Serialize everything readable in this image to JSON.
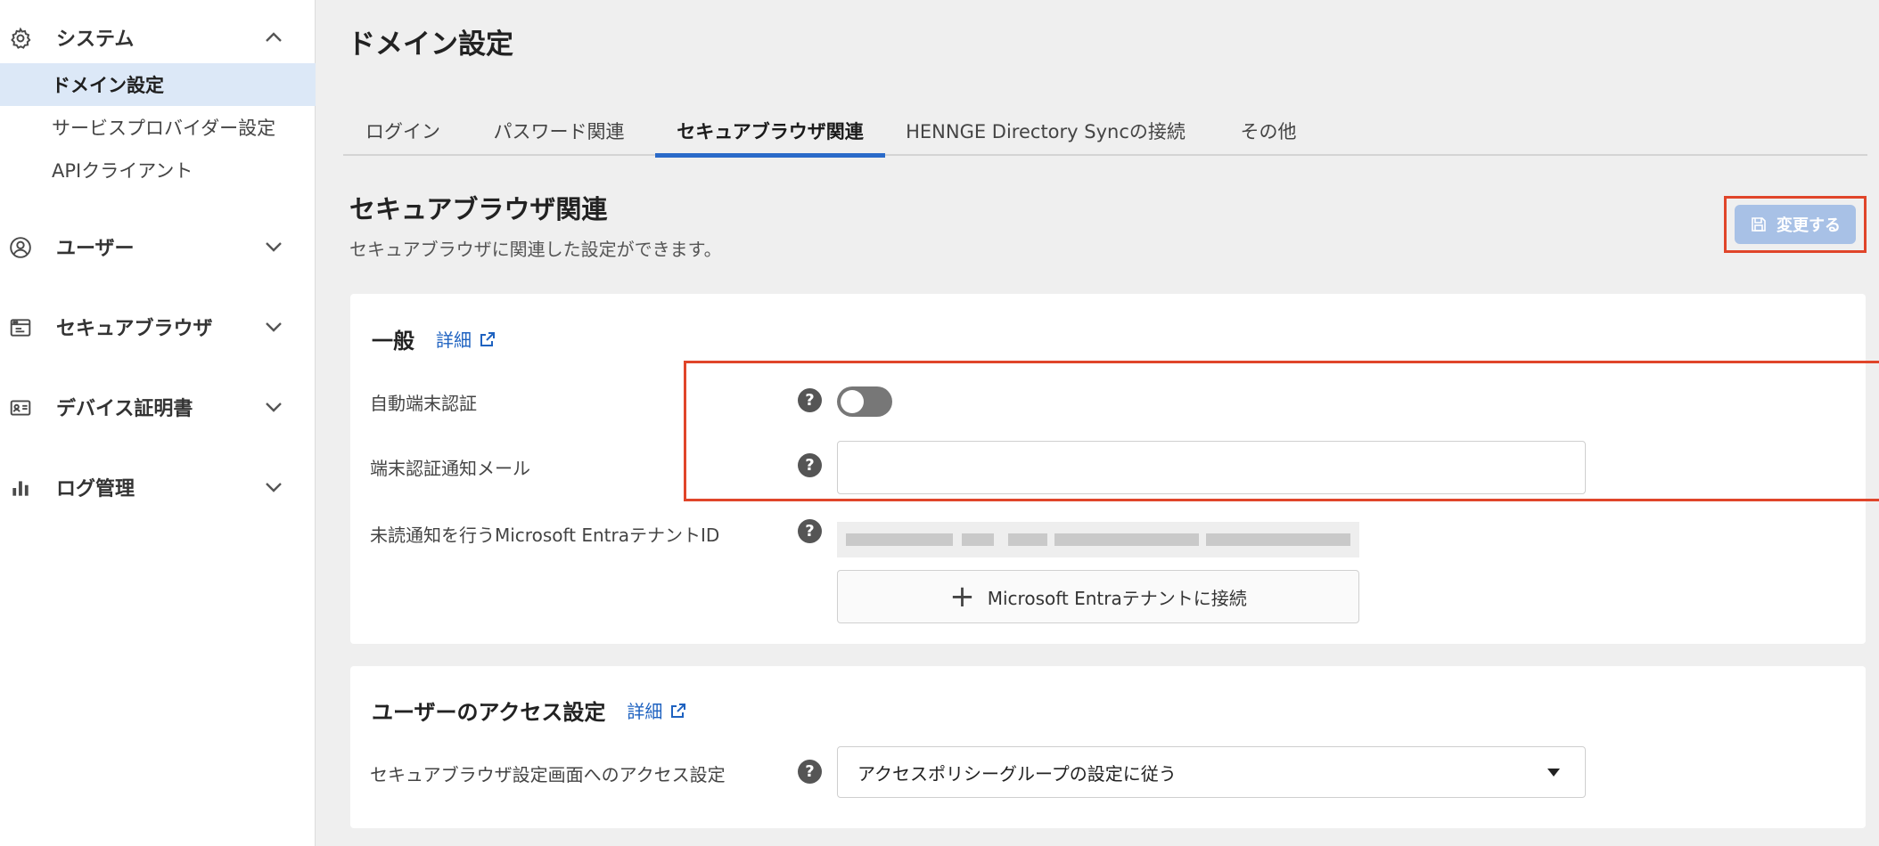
{
  "sidebar": {
    "groups": [
      {
        "label": "システム",
        "icon": "gear-icon",
        "expanded": true
      },
      {
        "label": "ユーザー",
        "icon": "user-circle-icon",
        "expanded": false
      },
      {
        "label": "セキュアブラウザ",
        "icon": "browser-window-icon",
        "expanded": false
      },
      {
        "label": "デバイス証明書",
        "icon": "id-card-icon",
        "expanded": false
      },
      {
        "label": "ログ管理",
        "icon": "bar-chart-icon",
        "expanded": false
      }
    ],
    "system_items": [
      {
        "label": "ドメイン設定",
        "active": true
      },
      {
        "label": "サービスプロバイダー設定",
        "active": false
      },
      {
        "label": "APIクライアント",
        "active": false
      }
    ]
  },
  "page": {
    "title": "ドメイン設定",
    "tabs": [
      {
        "label": "ログイン"
      },
      {
        "label": "パスワード関連"
      },
      {
        "label": "セキュアブラウザ関連",
        "active": true
      },
      {
        "label": "HENNGE Directory Syncの接続"
      },
      {
        "label": "その他"
      }
    ],
    "section_title": "セキュアブラウザ関連",
    "section_desc": "セキュアブラウザに関連した設定ができます。",
    "save_label": "変更する"
  },
  "general": {
    "title": "一般",
    "detail_link": "詳細",
    "auto_device_auth_label": "自動端末認証",
    "auto_device_auth_enabled": false,
    "notify_mail_label": "端末認証通知メール",
    "notify_mail_value": "",
    "tenant_label": "未読通知を行うMicrosoft EntraテナントID",
    "connect_button": "Microsoft Entraテナントに接続"
  },
  "access": {
    "title": "ユーザーのアクセス設定",
    "detail_link": "詳細",
    "setting_label": "セキュアブラウザ設定画面へのアクセス設定",
    "setting_value": "アクセスポリシーグループの設定に従う"
  },
  "help_glyph": "?",
  "colors": {
    "accent": "#2a6ac9",
    "link": "#1e62c0",
    "highlight": "#e0452a",
    "active_nav_bg": "#dce8f7",
    "save_button_disabled": "#a8c1e6"
  }
}
